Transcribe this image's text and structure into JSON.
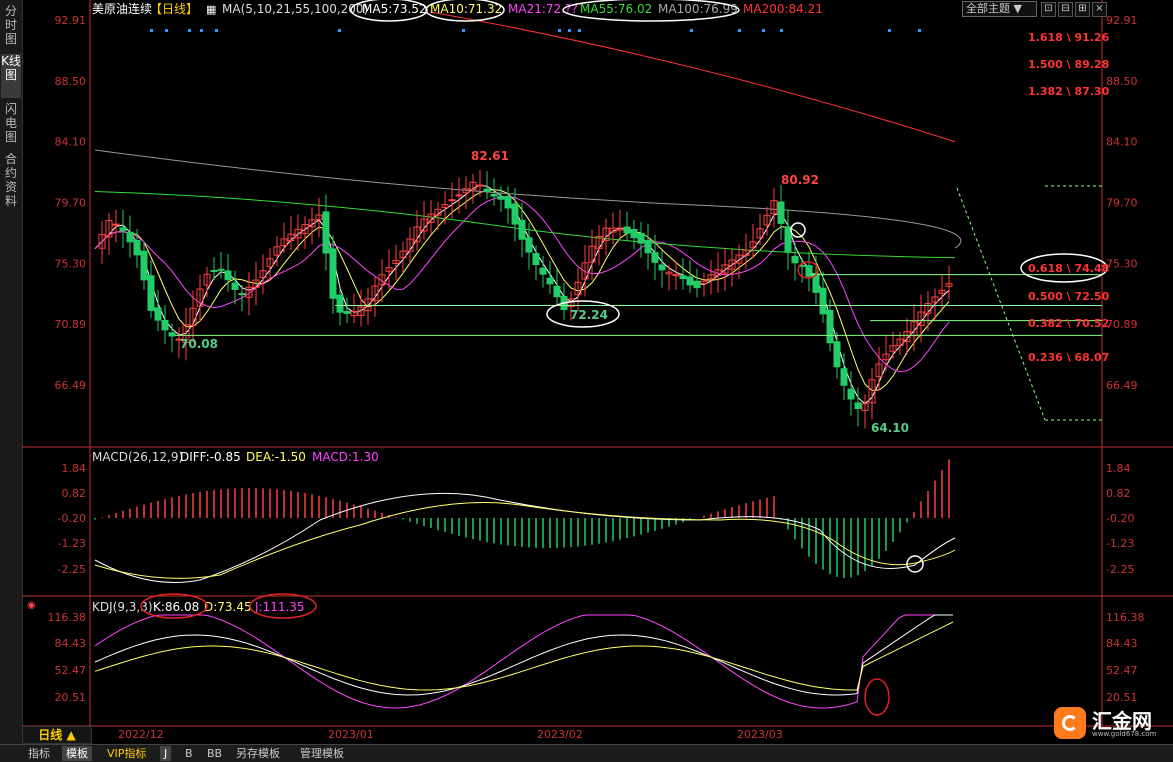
{
  "sidebar": {
    "tabs": [
      {
        "label": "分时图",
        "active": false
      },
      {
        "label": "K线图",
        "active": true
      },
      {
        "label": "闪电图",
        "active": false
      },
      {
        "label": "合约资料",
        "active": false
      }
    ]
  },
  "header": {
    "title": "美原油连续",
    "period": "【日线】",
    "ma_label": "MA(5,10,21,55,100,200)",
    "ma5": "MA5:73.52",
    "ma10": "MA10:71.32",
    "ma21": "MA21:72.??",
    "ma55": "MA55:76.02",
    "ma100": "MA100:76.99",
    "ma200": "MA200:84.21",
    "theme_label": "全部主题",
    "theme_arrow": "▼"
  },
  "window_buttons": [
    "⊡",
    "⊟",
    "⊞",
    "×"
  ],
  "main_axis": {
    "ticks": [
      "92.91",
      "88.50",
      "84.10",
      "79.70",
      "75.30",
      "70.89",
      "66.49"
    ]
  },
  "price_annotations": {
    "high1": "82.61",
    "high2": "80.92",
    "low1": "70.08",
    "low2": "72.24",
    "low3": "64.10"
  },
  "fib_levels": [
    {
      "label": "1.618 \\ 91.26"
    },
    {
      "label": "1.500 \\ 89.28"
    },
    {
      "label": "1.382 \\ 87.30"
    },
    {
      "label": "0.618 \\ 74.48"
    },
    {
      "label": "0.500 \\ 72.50"
    },
    {
      "label": "0.382 \\ 70.52"
    },
    {
      "label": "0.236 \\ 68.07"
    }
  ],
  "macd": {
    "title": "MACD(26,12,9)",
    "diff": "DIFF:-0.85",
    "dea": "DEA:-1.50",
    "macd": "MACD:1.30",
    "ticks": [
      "1.84",
      "0.82",
      "-0.20",
      "-1.23",
      "-2.25"
    ]
  },
  "kdj": {
    "title": "KDJ(9,3,3)",
    "k": "K:86.08",
    "d": "D:73.45",
    "j": "J:111.35",
    "ticks": [
      "116.38",
      "84.43",
      "52.47",
      "20.51"
    ]
  },
  "x_axis": {
    "labels": [
      "2022/12",
      "2023/01",
      "2023/02",
      "2023/03"
    ]
  },
  "period_button": "日线 ▲",
  "bottom_tabs": [
    {
      "label": "指标",
      "active": false
    },
    {
      "label": "模板",
      "active": true
    },
    {
      "label": "VIP指标",
      "active": false
    },
    {
      "label": "J",
      "active": true
    },
    {
      "label": "B",
      "active": false
    },
    {
      "label": "BB",
      "active": false
    },
    {
      "label": "另存模板",
      "active": false
    },
    {
      "label": "管理模板",
      "active": false
    }
  ],
  "logo": {
    "name": "汇金网",
    "url": "www.gold678.com"
  },
  "colors": {
    "up": "#ff4040",
    "down": "#22cc66",
    "ma5": "#ffffff",
    "ma10": "#ffff66",
    "ma21": "#ff44ff",
    "ma55": "#33dd33",
    "ma100": "#999999",
    "ma200": "#ff3333",
    "fib_lines": "#88ff88",
    "axis_text": "#cc3333"
  }
}
